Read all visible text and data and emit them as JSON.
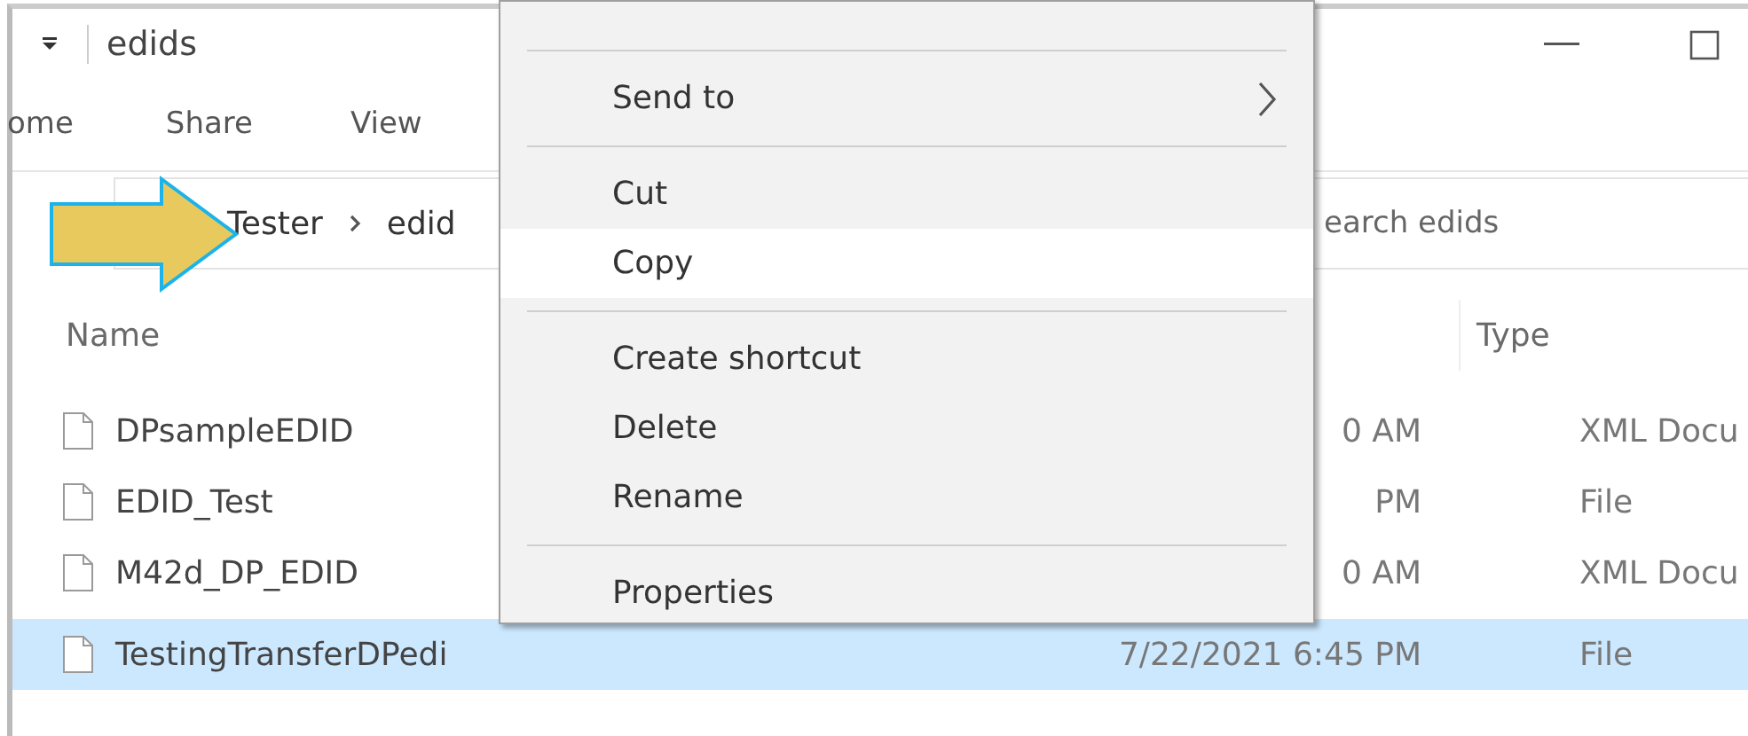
{
  "window": {
    "title": "edids"
  },
  "ribbon_tabs": [
    "ome",
    "Share",
    "View"
  ],
  "breadcrumb": [
    "Tester",
    "edid"
  ],
  "search": {
    "placeholder": "earch edids"
  },
  "table": {
    "columns": [
      "Name",
      "Type"
    ],
    "rows": [
      {
        "name": "DPsampleEDID",
        "column_2": "0 AM",
        "type": "XML Docu",
        "selected": false
      },
      {
        "name": "EDID_Test",
        "column_2": "PM",
        "type": "File",
        "selected": false
      },
      {
        "name": "M42d_DP_EDID",
        "column_2": "0 AM",
        "type": "XML Docu",
        "selected": false
      },
      {
        "name": "TestingTransferDPedi",
        "column_2": "7/22/2021 6:45 PM",
        "type": "File",
        "selected": true
      }
    ]
  },
  "context_menu": [
    {
      "kind": "separator"
    },
    {
      "kind": "item",
      "label": "Send to",
      "submenu": true,
      "hovered": false
    },
    {
      "kind": "separator"
    },
    {
      "kind": "item",
      "label": "Cut",
      "submenu": false,
      "hovered": false
    },
    {
      "kind": "item",
      "label": "Copy",
      "submenu": false,
      "hovered": true
    },
    {
      "kind": "separator"
    },
    {
      "kind": "item",
      "label": "Create shortcut",
      "submenu": false,
      "hovered": false
    },
    {
      "kind": "item",
      "label": "Delete",
      "submenu": false,
      "hovered": false
    },
    {
      "kind": "item",
      "label": "Rename",
      "submenu": false,
      "hovered": false
    },
    {
      "kind": "separator"
    },
    {
      "kind": "item",
      "label": "Properties",
      "submenu": false,
      "hovered": false
    }
  ]
}
